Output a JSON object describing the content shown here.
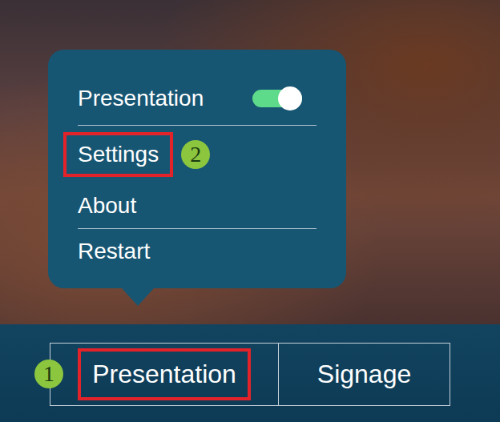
{
  "menu": {
    "items": [
      {
        "label": "Presentation",
        "kind": "toggle",
        "on": true,
        "highlighted": false,
        "group": 1
      },
      {
        "label": "Settings",
        "kind": "link",
        "highlighted": true,
        "badge": "2",
        "group": 2
      },
      {
        "label": "About",
        "kind": "link",
        "highlighted": false,
        "group": 2
      },
      {
        "label": "Restart",
        "kind": "link",
        "highlighted": false,
        "group": 3
      }
    ]
  },
  "bottom_bar": {
    "buttons": [
      {
        "label": "Presentation",
        "selected": true,
        "highlighted": true,
        "badge": "1"
      },
      {
        "label": "Signage",
        "selected": false,
        "highlighted": false
      }
    ]
  }
}
